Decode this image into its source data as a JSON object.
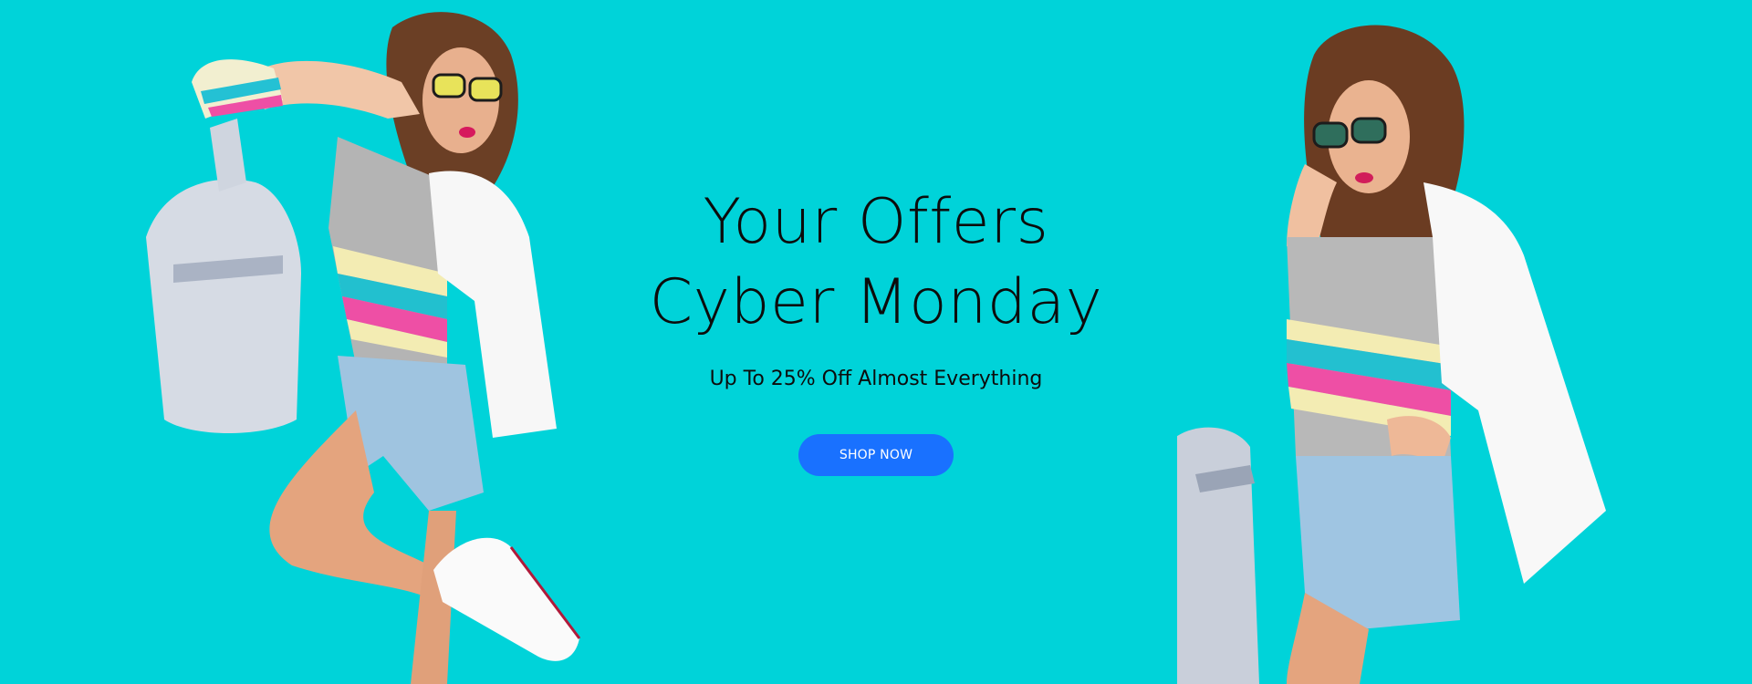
{
  "banner": {
    "title_line1": "Your Offers",
    "title_line2": "Cyber Monday",
    "subtitle": "Up To 25% Off Almost Everything",
    "button_label": "SHOP NOW"
  },
  "colors": {
    "background": "#00d3d9",
    "button": "#1971ff",
    "button_text": "#ffffff",
    "text": "#0c0c0c"
  },
  "images": {
    "left": "fashion-model-with-silver-backpack",
    "right": "fashion-model-with-white-jacket"
  }
}
